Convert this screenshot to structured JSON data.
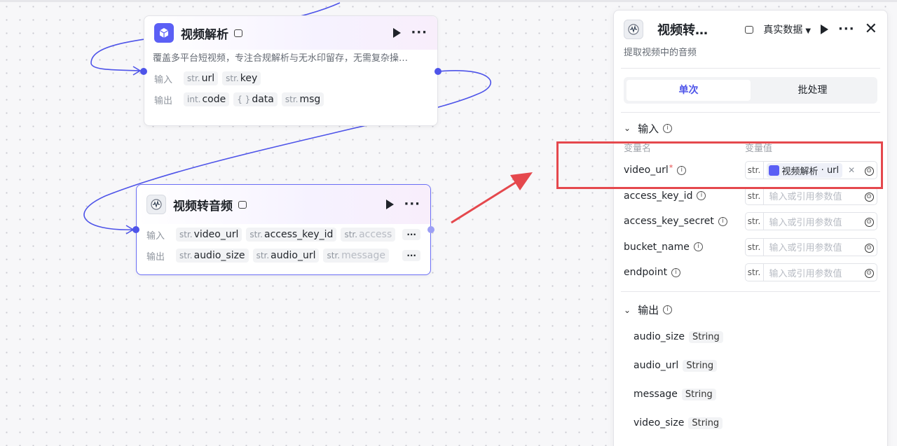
{
  "colors": {
    "accent": "#4e54e9",
    "highlight": "#e5484d",
    "arrow": "#e5484d"
  },
  "node1": {
    "icon": "cube-icon",
    "title": "视频解析",
    "description": "覆盖多平台短视频，专注合规解析与无水印留存，无需复杂操…",
    "input_label": "输入",
    "output_label": "输出",
    "inputs": [
      {
        "type": "str.",
        "name": "url"
      },
      {
        "type": "str.",
        "name": "key"
      }
    ],
    "outputs": [
      {
        "type": "int.",
        "name": "code"
      },
      {
        "type": "{ }",
        "name": "data"
      },
      {
        "type": "str.",
        "name": "msg"
      }
    ]
  },
  "node2": {
    "icon": "audio-icon",
    "title": "视频转音频",
    "input_label": "输入",
    "output_label": "输出",
    "inputs": [
      {
        "type": "str.",
        "name": "video_url"
      },
      {
        "type": "str.",
        "name": "access_key_id"
      },
      {
        "type": "str.",
        "name": "access"
      }
    ],
    "outputs": [
      {
        "type": "str.",
        "name": "audio_size"
      },
      {
        "type": "str.",
        "name": "audio_url"
      },
      {
        "type": "str.",
        "name": "message"
      }
    ],
    "more": "···"
  },
  "panel": {
    "title": "视频转…",
    "data_mode": "真实数据",
    "subtitle": "提取视频中的音频",
    "tabs": [
      "单次",
      "批处理"
    ],
    "input_section": "输入",
    "col_name": "变量名",
    "col_value": "变量值",
    "placeholder": "输入或引用参数值",
    "type_short": "str.",
    "params": [
      {
        "name": "video_url",
        "required": "*",
        "ref_node": "视频解析",
        "ref_field": "url"
      },
      {
        "name": "access_key_id"
      },
      {
        "name": "access_key_secret"
      },
      {
        "name": "bucket_name"
      },
      {
        "name": "endpoint"
      }
    ],
    "output_section": "输出",
    "outputs": [
      {
        "name": "audio_size",
        "type": "String"
      },
      {
        "name": "audio_url",
        "type": "String"
      },
      {
        "name": "message",
        "type": "String"
      },
      {
        "name": "video_size",
        "type": "String"
      }
    ]
  }
}
